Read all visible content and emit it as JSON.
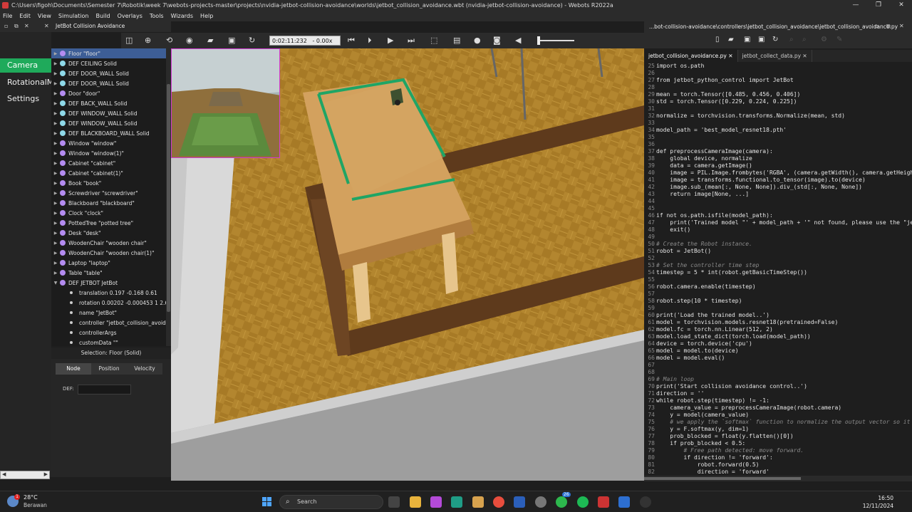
{
  "window": {
    "title": "C:\\Users\\figoh\\Documents\\Semester 7\\Robotik\\week 7\\webots-projects-master\\projects\\nvidia-jetbot-collision-avoidance\\worlds\\jetbot_collision_avoidance.wbt (nvidia-jetbot-collision-avoidance) - Webots R2022a",
    "minimize": "—",
    "maximize": "❐",
    "close": "✕"
  },
  "menu": [
    "File",
    "Edit",
    "View",
    "Simulation",
    "Build",
    "Overlays",
    "Tools",
    "Wizards",
    "Help"
  ],
  "left_tabs": [
    {
      "label": "Camera",
      "active": true
    },
    {
      "label": "RotationalMotor",
      "active": false
    },
    {
      "label": "Settings",
      "active": false
    }
  ],
  "scene_panel": {
    "title": "JetBot Collision Avoidance",
    "tree": [
      {
        "label": "Floor \"floor\"",
        "selected": true,
        "color": "#b48cf0"
      },
      {
        "label": "DEF CEILING Solid",
        "color": "#8fd9e8"
      },
      {
        "label": "DEF DOOR_WALL Solid",
        "color": "#8fd9e8"
      },
      {
        "label": "DEF DOOR_WALL Solid",
        "color": "#8fd9e8"
      },
      {
        "label": "Door \"door\"",
        "color": "#b48cf0"
      },
      {
        "label": "DEF BACK_WALL Solid",
        "color": "#8fd9e8"
      },
      {
        "label": "DEF WINDOW_WALL Solid",
        "color": "#8fd9e8"
      },
      {
        "label": "DEF WINDOW_WALL Solid",
        "color": "#8fd9e8"
      },
      {
        "label": "DEF BLACKBOARD_WALL Solid",
        "color": "#8fd9e8"
      },
      {
        "label": "Window \"window\"",
        "color": "#b48cf0"
      },
      {
        "label": "Window \"window(1)\"",
        "color": "#b48cf0"
      },
      {
        "label": "Cabinet \"cabinet\"",
        "color": "#b48cf0"
      },
      {
        "label": "Cabinet \"cabinet(1)\"",
        "color": "#b48cf0"
      },
      {
        "label": "Book \"book\"",
        "color": "#b48cf0"
      },
      {
        "label": "Screwdriver \"screwdriver\"",
        "color": "#b48cf0"
      },
      {
        "label": "Blackboard \"blackboard\"",
        "color": "#b48cf0"
      },
      {
        "label": "Clock \"clock\"",
        "color": "#b48cf0"
      },
      {
        "label": "PottedTree \"potted tree\"",
        "color": "#b48cf0"
      },
      {
        "label": "Desk \"desk\"",
        "color": "#b48cf0"
      },
      {
        "label": "WoodenChair \"wooden chair\"",
        "color": "#b48cf0"
      },
      {
        "label": "WoodenChair \"wooden chair(1)\"",
        "color": "#b48cf0"
      },
      {
        "label": "Laptop \"laptop\"",
        "color": "#b48cf0"
      },
      {
        "label": "Table \"table\"",
        "color": "#b48cf0"
      },
      {
        "label": "DEF JETBOT JetBot",
        "color": "#b48cf0",
        "expanded": true
      }
    ],
    "jetbot_fields": [
      "translation 0.197 -0.168 0.61",
      "rotation 0.00202 -0.000453 1 2.69",
      "name \"JetBot\"",
      "controller \"jetbot_collision_avoida",
      "controllerArgs",
      "customData \"\""
    ],
    "selection": "Selection: Floor (Solid)",
    "field_tabs": [
      "Node",
      "Position",
      "Velocity"
    ],
    "def_label": "DEF:",
    "def_value": ""
  },
  "toolbar": {
    "time": "0:02:11:232",
    "speed": "- 0.00x"
  },
  "editor": {
    "title": "...bot-collision-avoidance\\controllers\\jetbot_collision_avoidance\\jetbot_collision_avoidance.py",
    "tabs": [
      {
        "label": "jetbot_collision_avoidance.py",
        "active": true
      },
      {
        "label": "jetbot_collect_data.py",
        "active": false
      }
    ],
    "code": [
      {
        "n": "25",
        "t": "import os.path"
      },
      {
        "n": "26",
        "t": ""
      },
      {
        "n": "27",
        "t": "from jetbot_python_control import JetBot"
      },
      {
        "n": "28",
        "t": ""
      },
      {
        "n": "29",
        "t": "mean = torch.Tensor([0.485, 0.456, 0.406])"
      },
      {
        "n": "30",
        "t": "std = torch.Tensor([0.229, 0.224, 0.225])"
      },
      {
        "n": "31",
        "t": ""
      },
      {
        "n": "32",
        "t": "normalize = torchvision.transforms.Normalize(mean, std)"
      },
      {
        "n": "33",
        "t": ""
      },
      {
        "n": "34",
        "t": "model_path = 'best_model_resnet18.pth'"
      },
      {
        "n": "35",
        "t": ""
      },
      {
        "n": "36",
        "t": ""
      },
      {
        "n": "37",
        "t": "def preprocessCameraImage(camera):"
      },
      {
        "n": "38",
        "t": "    global device, normalize"
      },
      {
        "n": "39",
        "t": "    data = camera.getImage()"
      },
      {
        "n": "40",
        "t": "    image = PIL.Image.frombytes('RGBA', (camera.getWidth(), camera.getHeight"
      },
      {
        "n": "41",
        "t": "    image = transforms.functional.to_tensor(image).to(device)"
      },
      {
        "n": "42",
        "t": "    image.sub_(mean[:, None, None]).div_(std[:, None, None])"
      },
      {
        "n": "43",
        "t": "    return image[None, ...]"
      },
      {
        "n": "44",
        "t": ""
      },
      {
        "n": "45",
        "t": ""
      },
      {
        "n": "46",
        "t": "if not os.path.isfile(model_path):"
      },
      {
        "n": "47",
        "t": "    print('Trained model \"' + model_path + '\" not found, please use the \"jet"
      },
      {
        "n": "48",
        "t": "    exit()"
      },
      {
        "n": "49",
        "t": ""
      },
      {
        "n": "50",
        "t": "# Create the Robot instance."
      },
      {
        "n": "51",
        "t": "robot = JetBot()"
      },
      {
        "n": "52",
        "t": ""
      },
      {
        "n": "53",
        "t": "# Set the controller time step"
      },
      {
        "n": "54",
        "t": "timestep = 5 * int(robot.getBasicTimeStep())"
      },
      {
        "n": "55",
        "t": ""
      },
      {
        "n": "56",
        "t": "robot.camera.enable(timestep)"
      },
      {
        "n": "57",
        "t": ""
      },
      {
        "n": "58",
        "t": "robot.step(10 * timestep)"
      },
      {
        "n": "59",
        "t": ""
      },
      {
        "n": "60",
        "t": "print('Load the trained model..')"
      },
      {
        "n": "61",
        "t": "model = torchvision.models.resnet18(pretrained=False)"
      },
      {
        "n": "62",
        "t": "model.fc = torch.nn.Linear(512, 2)"
      },
      {
        "n": "63",
        "t": "model.load_state_dict(torch.load(model_path))"
      },
      {
        "n": "64",
        "t": "device = torch.device('cpu')"
      },
      {
        "n": "65",
        "t": "model = model.to(device)"
      },
      {
        "n": "66",
        "t": "model = model.eval()"
      },
      {
        "n": "67",
        "t": ""
      },
      {
        "n": "68",
        "t": ""
      },
      {
        "n": "69",
        "t": "# Main loop"
      },
      {
        "n": "70",
        "t": "print('Start collision avoidance control..')"
      },
      {
        "n": "71",
        "t": "direction = ''"
      },
      {
        "n": "72",
        "t": "while robot.step(timestep) != -1:"
      },
      {
        "n": "73",
        "t": "    camera_value = preprocessCameraImage(robot.camera)"
      },
      {
        "n": "74",
        "t": "    y = model(camera_value)"
      },
      {
        "n": "75",
        "t": "    # we apply the `softmax` function to normalize the output vector so it s"
      },
      {
        "n": "76",
        "t": "    y = F.softmax(y, dim=1)"
      },
      {
        "n": "77",
        "t": "    prob_blocked = float(y.flatten()[0])"
      },
      {
        "n": "78",
        "t": "    if prob_blocked < 0.5:"
      },
      {
        "n": "79",
        "t": "        # Free path detected: move forward."
      },
      {
        "n": "80",
        "t": "        if direction != 'forward':"
      },
      {
        "n": "81",
        "t": "            robot.forward(0.5)"
      },
      {
        "n": "82",
        "t": "            direction = 'forward'"
      }
    ]
  },
  "taskbar": {
    "temperature": "28°C",
    "weather": "Berawan",
    "weather_badge": "1",
    "search_placeholder": "Search",
    "time": "16:50",
    "date": "12/11/2024",
    "notif_count": "26"
  },
  "colors": {
    "accent_green": "#1faa5b",
    "selection_blue": "#3d5e96",
    "floor_wood": "#b0832d"
  }
}
